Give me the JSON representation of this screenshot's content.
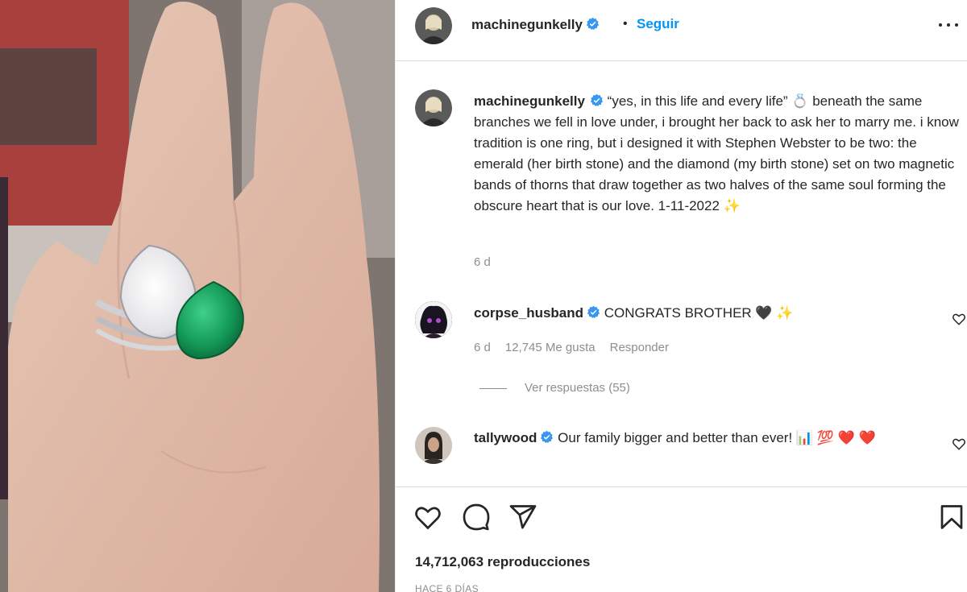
{
  "header": {
    "username": "machinegunkelly",
    "separator": "•",
    "follow_label": "Seguir"
  },
  "caption": {
    "username": "machinegunkelly",
    "text": "“yes, in this life and every life”  💍  beneath the same branches we fell in love under, i brought her back to ask her to marry me. i know tradition is one ring, but i designed it with Stephen Webster to be two: the emerald (her birth stone) and the diamond (my birth stone) set on two magnetic bands of thorns that draw together as two halves of the same soul forming the obscure heart that is our love. 1-11-2022 ✨",
    "time": "6 d"
  },
  "comments": [
    {
      "username": "corpse_husband",
      "text": "CONGRATS BROTHER 🖤 ✨",
      "time": "6 d",
      "likes": "12,745 Me gusta",
      "reply_label": "Responder",
      "view_replies": "Ver respuestas (55)"
    },
    {
      "username": "tallywood",
      "text": "Our family bigger and better than ever! 📊 💯 ❤️ ❤️"
    }
  ],
  "footer": {
    "views": "14,712,063 reproducciones",
    "date": "HACE 6 DÍAS"
  },
  "icons": {
    "verified": "verified-badge-icon",
    "like": "heart-icon",
    "comment": "comment-icon",
    "share": "share-icon",
    "save": "bookmark-icon",
    "more": "more-options-icon"
  },
  "colors": {
    "accent": "#0095f6",
    "verified": "#3897f0",
    "emerald": "#1f9a5a",
    "text": "#262626",
    "muted": "#8e8e8e"
  }
}
